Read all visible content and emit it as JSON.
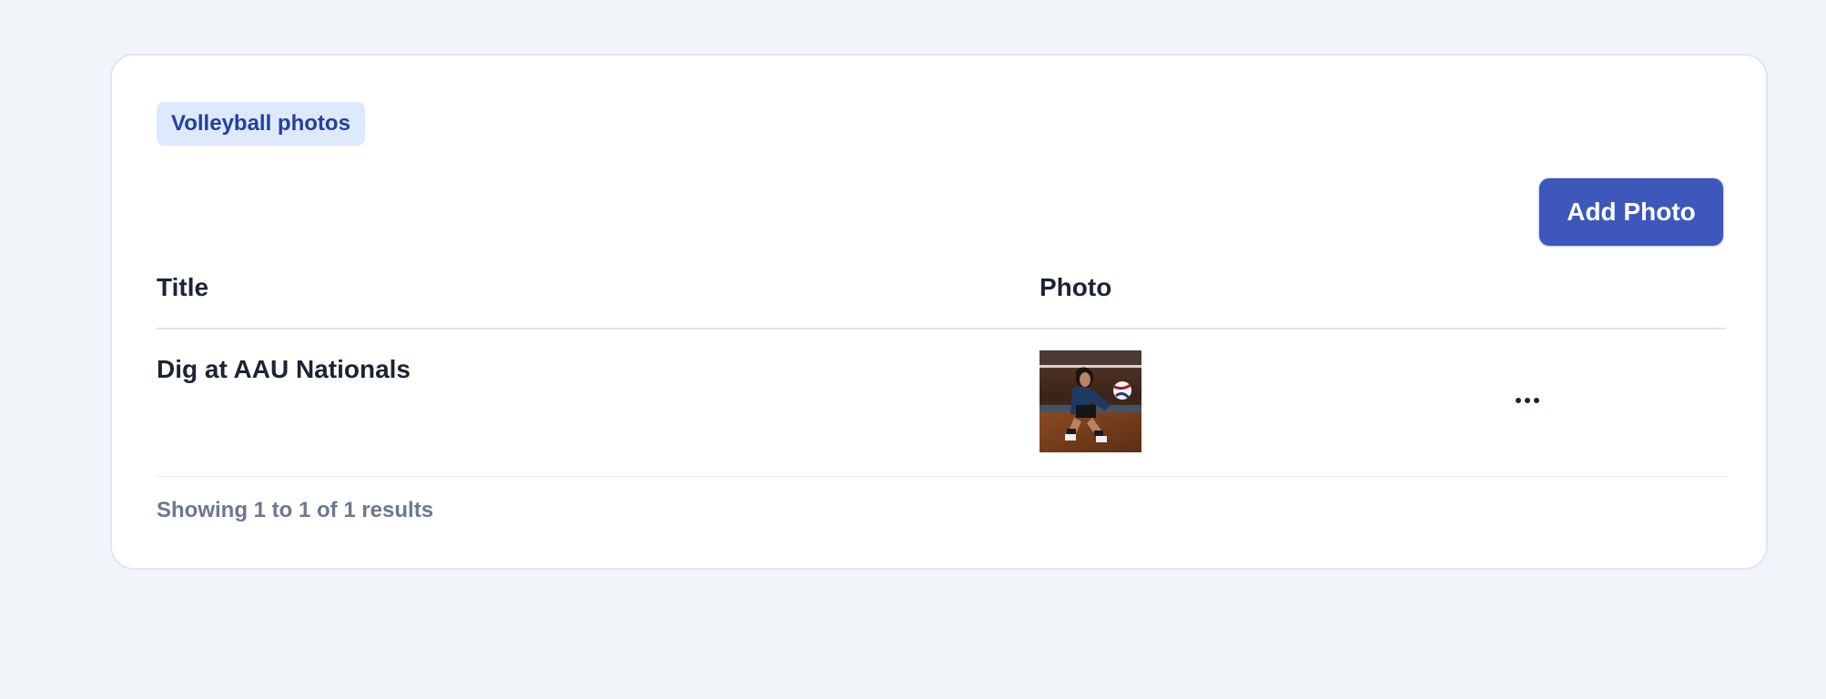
{
  "section": {
    "tag_label": "Volleyball photos"
  },
  "toolbar": {
    "add_photo_label": "Add Photo",
    "accent_color": "#3e57bd"
  },
  "table": {
    "columns": [
      "Title",
      "Photo"
    ],
    "rows": [
      {
        "title": "Dig at AAU Nationals",
        "photo_icon": "volleyball-player-photo",
        "actions_icon": "more-horizontal-icon"
      }
    ]
  },
  "pagination": {
    "summary": "Showing 1 to 1 of 1 results"
  }
}
